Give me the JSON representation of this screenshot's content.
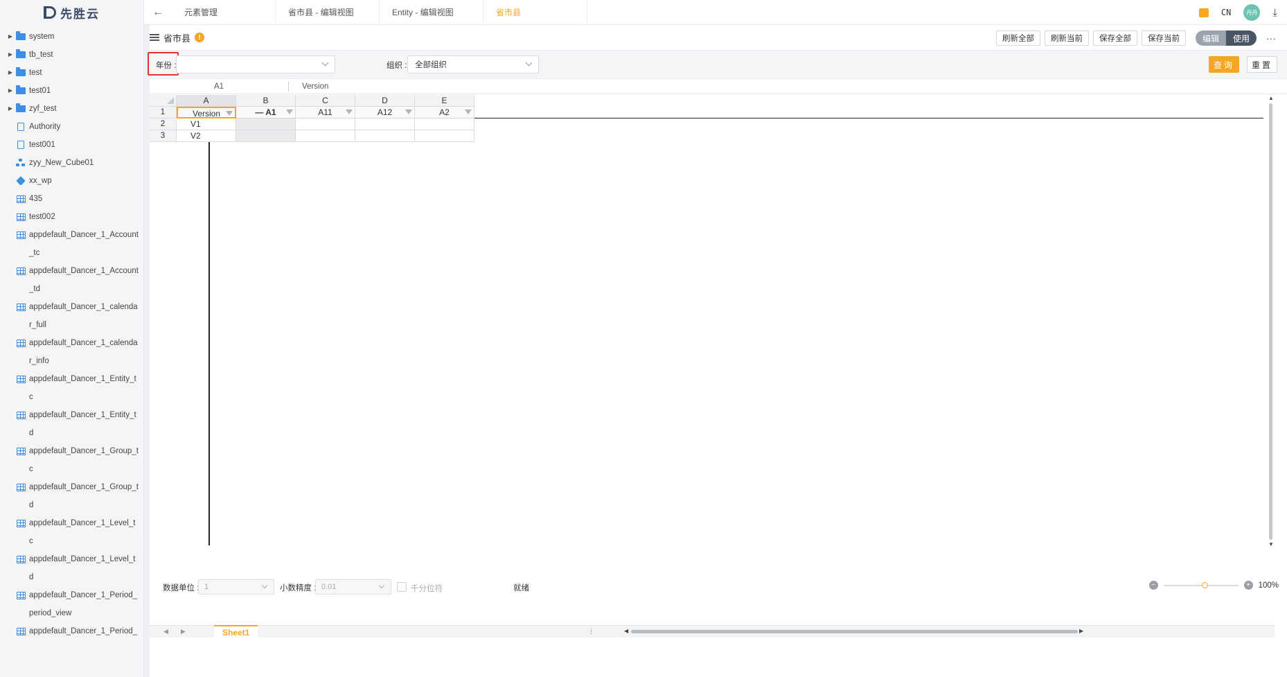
{
  "brand": {
    "name": "先胜云"
  },
  "sidebar": {
    "items": [
      {
        "label": "system",
        "icon": "folder-icon",
        "expandable": true
      },
      {
        "label": "tb_test",
        "icon": "folder-icon",
        "expandable": true
      },
      {
        "label": "test",
        "icon": "folder-icon",
        "expandable": true
      },
      {
        "label": "test01",
        "icon": "folder-icon",
        "expandable": true
      },
      {
        "label": "zyf_test",
        "icon": "folder-icon",
        "expandable": true
      },
      {
        "label": "Authority",
        "icon": "document-icon",
        "expandable": false
      },
      {
        "label": "test001",
        "icon": "document-icon",
        "expandable": false
      },
      {
        "label": "zyy_New_Cube01",
        "icon": "hierarchy-icon",
        "expandable": false
      },
      {
        "label": "xx_wp",
        "icon": "cube-icon",
        "expandable": false
      },
      {
        "label": "435",
        "icon": "table-icon",
        "expandable": false
      },
      {
        "label": "test002",
        "icon": "table-icon",
        "expandable": false
      },
      {
        "label": "appdefault_Dancer_1_Account_tc",
        "icon": "table-icon",
        "expandable": false
      },
      {
        "label": "appdefault_Dancer_1_Account_td",
        "icon": "table-icon",
        "expandable": false
      },
      {
        "label": "appdefault_Dancer_1_calendar_full",
        "icon": "table-icon",
        "expandable": false
      },
      {
        "label": "appdefault_Dancer_1_calendar_info",
        "icon": "table-icon",
        "expandable": false
      },
      {
        "label": "appdefault_Dancer_1_Entity_tc",
        "icon": "table-icon",
        "expandable": false
      },
      {
        "label": "appdefault_Dancer_1_Entity_td",
        "icon": "table-icon",
        "expandable": false
      },
      {
        "label": "appdefault_Dancer_1_Group_tc",
        "icon": "table-icon",
        "expandable": false
      },
      {
        "label": "appdefault_Dancer_1_Group_td",
        "icon": "table-icon",
        "expandable": false
      },
      {
        "label": "appdefault_Dancer_1_Level_tc",
        "icon": "table-icon",
        "expandable": false
      },
      {
        "label": "appdefault_Dancer_1_Level_td",
        "icon": "table-icon",
        "expandable": false
      },
      {
        "label": "appdefault_Dancer_1_Period_period_view",
        "icon": "table-icon",
        "expandable": false
      },
      {
        "label": "appdefault_Dancer_1_Period_",
        "icon": "table-icon",
        "expandable": false
      }
    ]
  },
  "topbar": {
    "tabs": [
      {
        "label": "元素管理",
        "active": false
      },
      {
        "label": "省市县 - 编辑视图",
        "active": false
      },
      {
        "label": "Entity - 编辑视图",
        "active": false
      },
      {
        "label": "省市县",
        "active": true
      }
    ],
    "lang": "CN",
    "avatar_text": "丹丹"
  },
  "toolbar": {
    "title": "省市县",
    "info_badge": "!",
    "buttons": [
      "刷新全部",
      "刷新当前",
      "保存全部",
      "保存当前"
    ],
    "mode_edit": "编辑",
    "mode_use": "使用",
    "more": "···"
  },
  "filter": {
    "year_label": "年份 :",
    "year_value": "",
    "org_label": "组织 :",
    "org_value": "全部组织",
    "query_label": "查询",
    "reset_label": "重置"
  },
  "formula": {
    "ref": "A1",
    "value": "Version"
  },
  "grid": {
    "columns": [
      "A",
      "B",
      "C",
      "D",
      "E"
    ],
    "rows": [
      "1",
      "2",
      "3"
    ],
    "header_row": [
      "Version",
      "— A1",
      "A11",
      "A12",
      "A2"
    ],
    "data": [
      [
        "V1",
        "",
        "",
        "",
        ""
      ],
      [
        "V2",
        "",
        "",
        "",
        ""
      ]
    ]
  },
  "sheet": {
    "tab": "Sheet1"
  },
  "status": {
    "unit_label": "数据单位 :",
    "unit_value": "1",
    "precision_label": "小数精度 :",
    "precision_value": "0.01",
    "thousands_label": "千分位符",
    "ready": "就绪",
    "zoom": "100%"
  },
  "colors": {
    "accent": "#f5a623",
    "folder": "#3d8fe6",
    "highlight_border": "#e03030"
  }
}
